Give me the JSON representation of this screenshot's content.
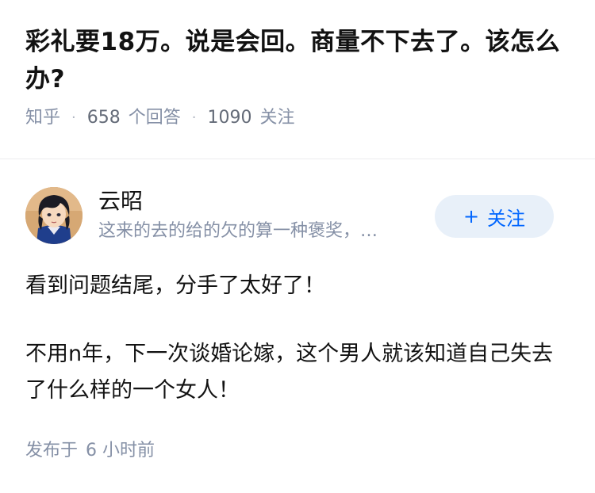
{
  "question": {
    "title": "彩礼要18万。说是会回。商量不下去了。该怎么办?",
    "source": "知乎",
    "answer_count": "658",
    "answer_count_label": "个回答",
    "follower_count": "1090",
    "follower_label": "关注"
  },
  "author": {
    "name": "云昭",
    "bio": "这来的去的给的欠的算一种褒奖，…",
    "follow_label": "关注",
    "follow_icon": "plus-icon",
    "avatar_icon": "anime-character-avatar"
  },
  "answer": {
    "paragraphs": [
      "看到问题结尾，分手了太好了！",
      "不用n年，下一次谈婚论嫁，这个男人就该知道自己失去了什么样的一个女人！"
    ]
  },
  "post_time": {
    "label": "发布于",
    "value": "6 小时前"
  },
  "colors": {
    "meta_gray": "#8590a6",
    "accent_blue": "#0066ff",
    "button_bg": "#e8f0f9"
  }
}
